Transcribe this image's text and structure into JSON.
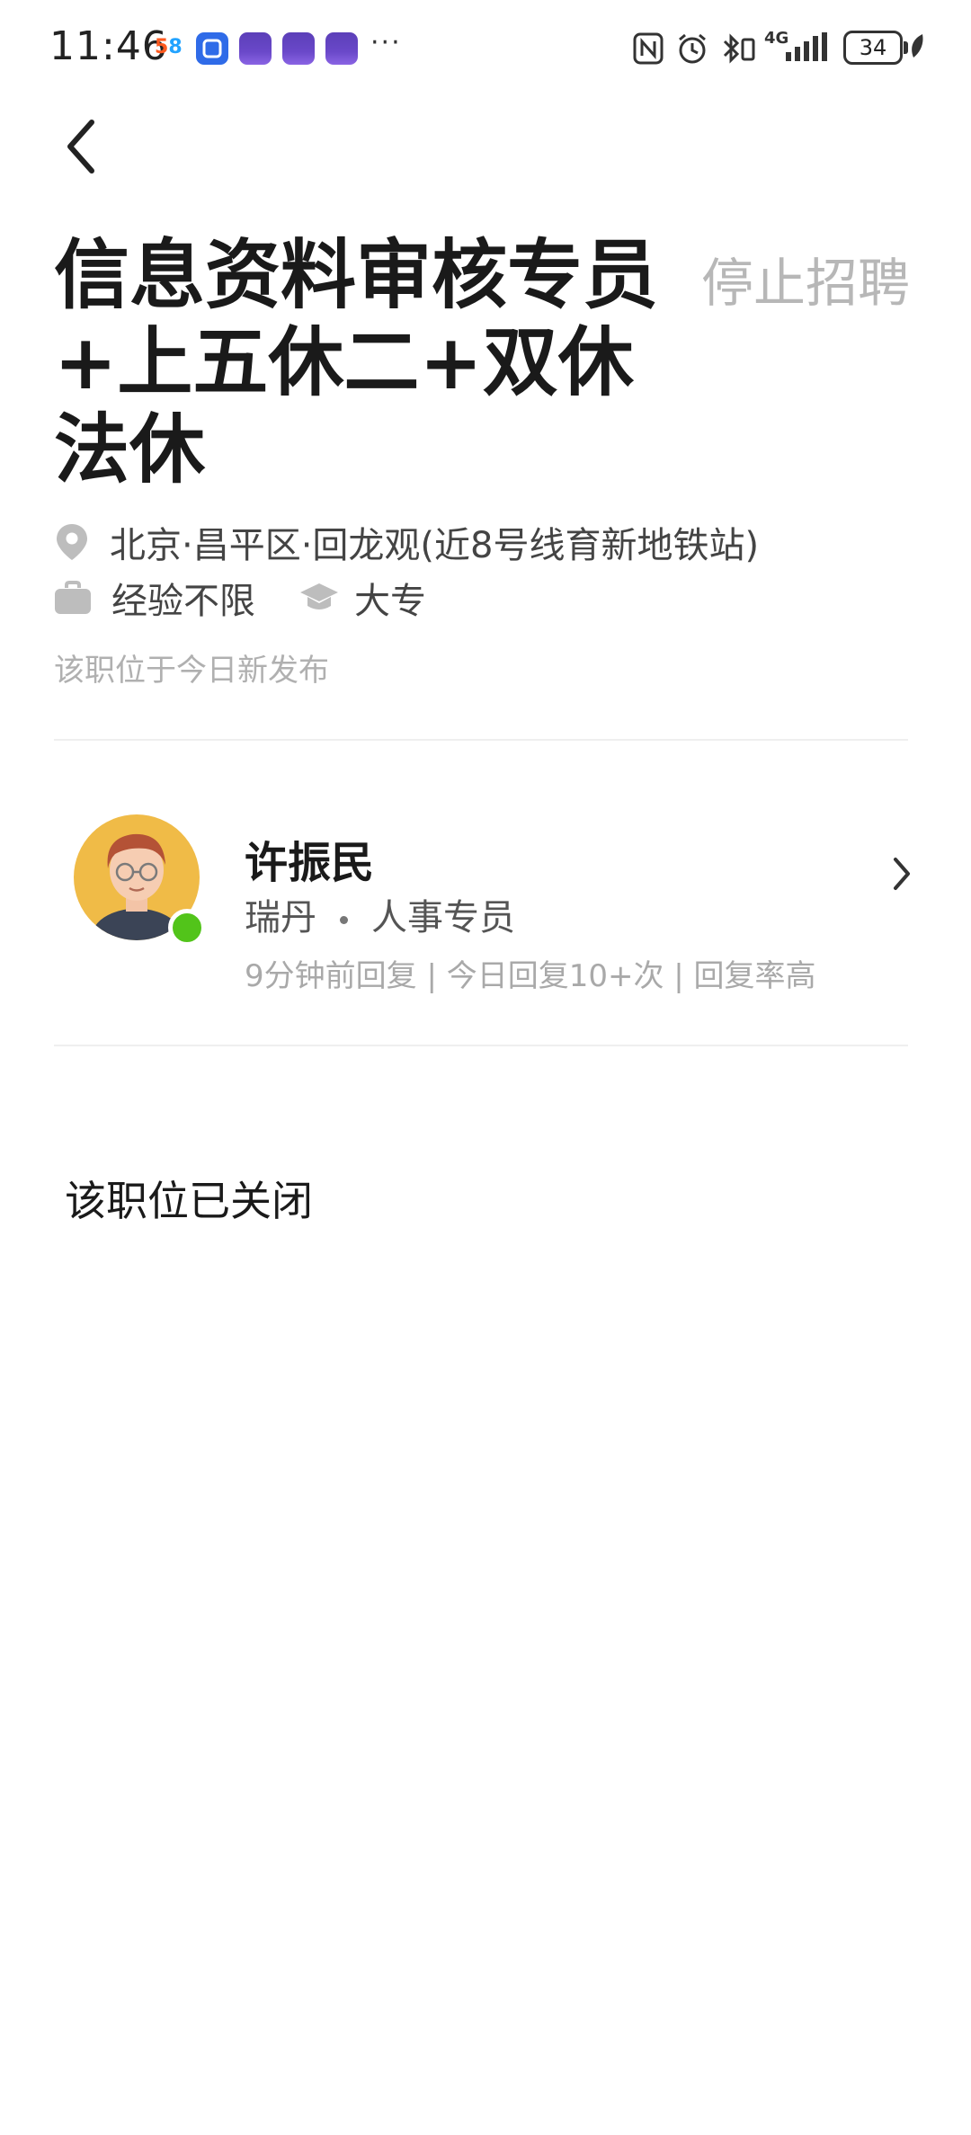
{
  "status_bar": {
    "time": "11:46",
    "app_58_a": "5",
    "app_58_b": "8",
    "overflow": "···",
    "network": "4G",
    "battery": "34"
  },
  "job": {
    "title": "信息资料审核专员+上五休二+双休法休",
    "stop_hiring_label": "停止招聘",
    "location": "北京·昌平区·回龙观(近8号线育新地铁站)",
    "experience": "经验不限",
    "education": "大专",
    "posted_note": "该职位于今日新发布"
  },
  "recruiter": {
    "name": "许振民",
    "company": "瑞丹",
    "position": "人事专员",
    "activity": "9分钟前回复 | 今日回复10+次 | 回复率高"
  },
  "closed_message": "该职位已关闭",
  "colors": {
    "online": "#52c41a",
    "muted_text": "#b0b0b0",
    "avatar_bg": "#f0bb47"
  }
}
